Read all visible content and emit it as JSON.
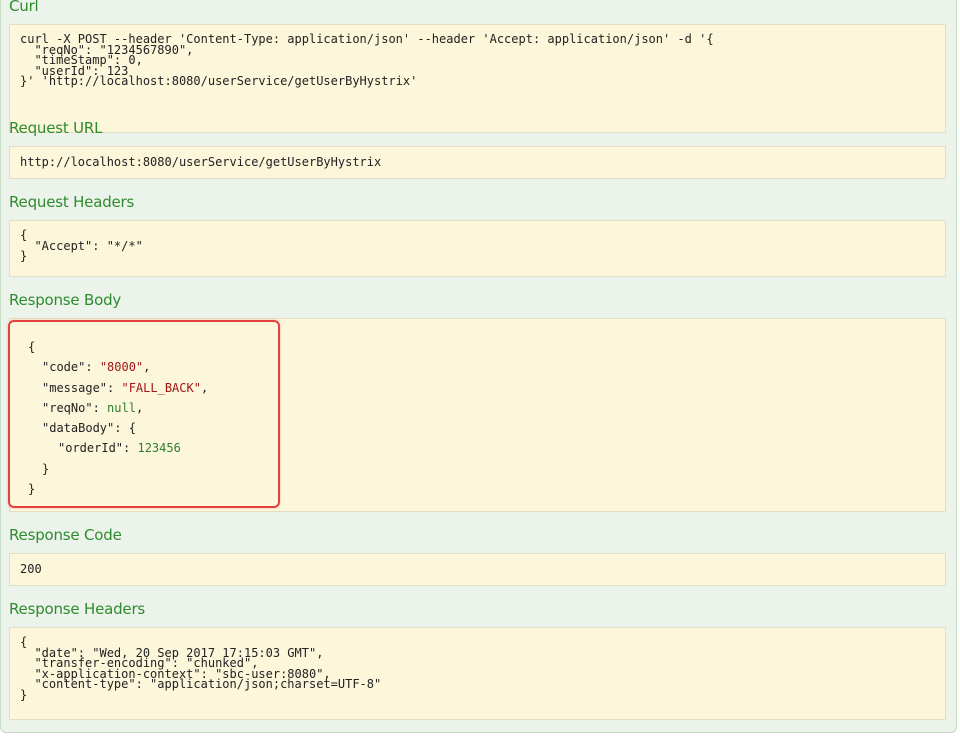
{
  "sections": {
    "curl": {
      "title": "Curl",
      "lines": [
        "curl -X POST --header 'Content-Type: application/json' --header 'Accept: application/json' -d '{",
        "  \"reqNo\": \"1234567890\",",
        "  \"timeStamp\": 0,",
        "  \"userId\": 123",
        "}' 'http://localhost:8080/userService/getUserByHystrix'"
      ]
    },
    "request_url": {
      "title": "Request URL",
      "value": "http://localhost:8080/userService/getUserByHystrix"
    },
    "request_headers": {
      "title": "Request Headers",
      "lines": [
        "{",
        "  \"Accept\": \"*/*\"",
        "}"
      ]
    },
    "response_body": {
      "title": "Response Body",
      "open": "{",
      "code_key": "\"code\"",
      "code_val": "\"8000\"",
      "message_key": "\"message\"",
      "message_val": "\"FALL_BACK\"",
      "reqno_key": "\"reqNo\"",
      "reqno_val": "null",
      "databody_key": "\"dataBody\"",
      "databody_open": "{",
      "orderid_key": "\"orderId\"",
      "orderid_val": "123456",
      "databody_close": "}",
      "close": "}"
    },
    "response_code": {
      "title": "Response Code",
      "value": "200"
    },
    "response_headers": {
      "title": "Response Headers",
      "lines": [
        "{",
        "  \"date\": \"Wed, 20 Sep 2017 17:15:03 GMT\",",
        "  \"transfer-encoding\": \"chunked\",",
        "  \"x-application-context\": \"sbc-user:8080\",",
        "  \"content-type\": \"application/json;charset=UTF-8\"",
        "}"
      ]
    }
  },
  "colors": {
    "panel_bg": "#ebf3eb",
    "heading": "#2e8b2e",
    "code_bg": "#fcf6db",
    "string": "#a31515",
    "number": "#2e7d32",
    "highlight_border": "#e34040"
  }
}
